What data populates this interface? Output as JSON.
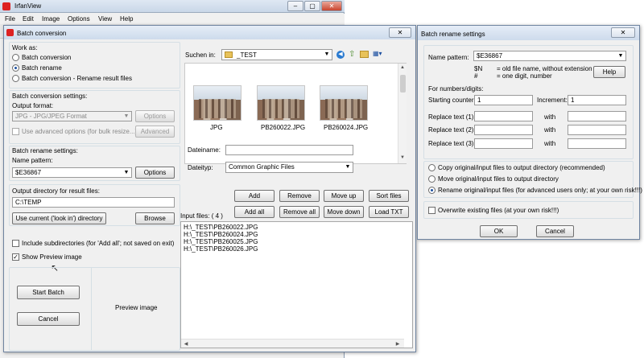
{
  "main": {
    "title": "IrfanView",
    "menu": [
      "File",
      "Edit",
      "Image",
      "Options",
      "View",
      "Help"
    ],
    "win_buttons": [
      "–",
      "▢",
      "✕"
    ]
  },
  "batch": {
    "title": "Batch conversion",
    "close": "✕",
    "work_as": {
      "label": "Work as:",
      "options": [
        "Batch conversion",
        "Batch rename",
        "Batch conversion - Rename result files"
      ],
      "selected": 1
    },
    "conv_settings": {
      "label": "Batch conversion settings:",
      "output_format_label": "Output format:",
      "output_format_value": "JPG - JPG/JPEG Format",
      "options_btn": "Options",
      "advanced_check": "Use advanced options (for bulk resize...)",
      "advanced_btn": "Advanced"
    },
    "rename_settings": {
      "label": "Batch rename settings:",
      "pattern_label": "Name pattern:",
      "pattern_value": "$E36867",
      "options_btn": "Options"
    },
    "output_dir": {
      "label": "Output directory for result files:",
      "value": "C:\\TEMP",
      "use_current_btn": "Use current ('look in') directory",
      "browse_btn": "Browse"
    },
    "include_subdirs": "Include subdirectories (for 'Add all'; not saved on exit)",
    "show_preview": "Show Preview image",
    "start_btn": "Start Batch",
    "cancel_btn": "Cancel",
    "preview_label": "Preview image",
    "browser": {
      "look_in_label": "Suchen in:",
      "look_in_value": "_TEST",
      "thumbs": [
        "JPG",
        "PB260022.JPG",
        "PB260024.JPG"
      ],
      "filename_label": "Dateiname:",
      "filename_value": "",
      "filetype_label": "Dateityp:",
      "filetype_value": "Common Graphic Files"
    },
    "actions": {
      "add": "Add",
      "remove": "Remove",
      "move_up": "Move up",
      "sort": "Sort files",
      "add_all": "Add all",
      "remove_all": "Remove all",
      "move_down": "Move down",
      "load_txt": "Load TXT"
    },
    "input_files_label": "Input files: ( 4 )",
    "input_files": [
      "H:\\_TEST\\PB260022.JPG",
      "H:\\_TEST\\PB260024.JPG",
      "H:\\_TEST\\PB260025.JPG",
      "H:\\_TEST\\PB260026.JPG"
    ]
  },
  "rename": {
    "title": "Batch rename settings",
    "close": "✕",
    "pattern_label": "Name pattern:",
    "pattern_value": "$E36867",
    "help_n_key": "$N",
    "help_n": "= old file name, without extension",
    "help_hash_key": "#",
    "help_hash": "= one digit, number",
    "help_btn": "Help",
    "digits_label": "For numbers/digits:",
    "start_counter_label": "Starting counter:",
    "start_counter_value": "1",
    "increment_label": "Increment:",
    "increment_value": "1",
    "replace": [
      {
        "label": "Replace text (1):",
        "with": "with"
      },
      {
        "label": "Replace text (2):",
        "with": "with"
      },
      {
        "label": "Replace text (3):",
        "with": "with"
      }
    ],
    "file_ops": [
      "Copy original/input files to output directory (recommended)",
      "Move original/input files to output directory",
      "Rename original/input files (for advanced users only; at your own risk!!!)"
    ],
    "file_ops_selected": 2,
    "overwrite": "Overwrite existing files (at your own risk!!!)",
    "ok": "OK",
    "cancel": "Cancel"
  },
  "colors": {
    "title_bar": "#cddbec",
    "close_red": "#c8452f",
    "dialog_bg": "#f0f0f0",
    "radio_dot": "#1b4fa0"
  }
}
